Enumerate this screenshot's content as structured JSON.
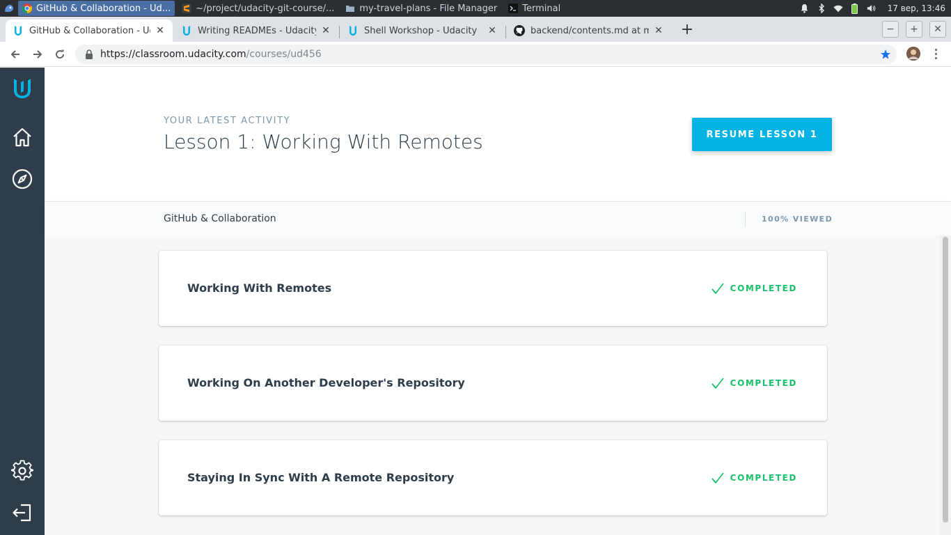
{
  "taskbar": {
    "tasks": [
      {
        "label": "GitHub & Collaboration - Ud...",
        "active": true
      },
      {
        "label": "~/project/udacity-git-course/...",
        "active": false
      },
      {
        "label": "my-travel-plans - File Manager",
        "active": false
      },
      {
        "label": "Terminal",
        "active": false
      }
    ],
    "clock": "17 вер, 13:46"
  },
  "tabs": [
    {
      "label": "GitHub & Collaboration - Udacity",
      "active": true
    },
    {
      "label": "Writing READMEs - Udacity",
      "active": false
    },
    {
      "label": "Shell Workshop - Udacity",
      "active": false
    },
    {
      "label": "backend/contents.md at master",
      "active": false
    }
  ],
  "address": {
    "host": "https://classroom.udacity.com",
    "path": "/courses/ud456"
  },
  "activity": {
    "kicker": "YOUR LATEST ACTIVITY",
    "title": "Lesson 1: Working With Remotes",
    "resume_label": "RESUME LESSON 1"
  },
  "course": {
    "name": "GitHub & Collaboration",
    "progress_label": "100% VIEWED",
    "progress_fraction": 1.0
  },
  "lessons": [
    {
      "title": "Working With Remotes",
      "status": "COMPLETED"
    },
    {
      "title": "Working On Another Developer's Repository",
      "status": "COMPLETED"
    },
    {
      "title": "Staying In Sync With A Remote Repository",
      "status": "COMPLETED"
    }
  ],
  "colors": {
    "accent": "#02b3e4",
    "sidebar": "#2e3d49",
    "completed": "#15c26b",
    "taskbar": "#2b2e33"
  }
}
